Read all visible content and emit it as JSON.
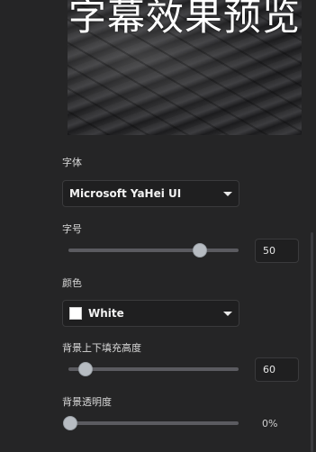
{
  "preview": {
    "text": "字幕效果预览"
  },
  "font": {
    "label": "字体",
    "value": "Microsoft YaHei UI"
  },
  "size": {
    "label": "字号",
    "value": "50",
    "fraction": 0.78
  },
  "color": {
    "label": "颜色",
    "value": "White",
    "swatch": "#ffffff"
  },
  "padding": {
    "label": "背景上下填充高度",
    "value": "60",
    "fraction": 0.09
  },
  "opacity": {
    "label": "背景透明度",
    "value": "0%",
    "fraction": 0.0
  },
  "icons": {
    "font_caret": "chevron-down-icon",
    "color_caret": "chevron-down-icon"
  }
}
